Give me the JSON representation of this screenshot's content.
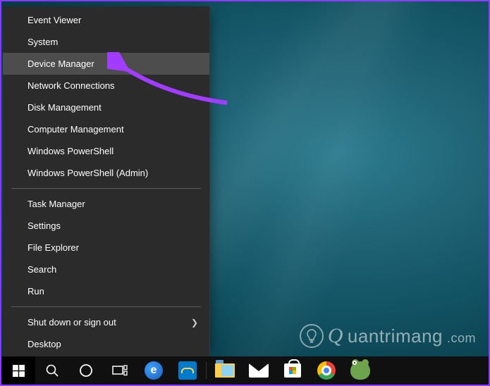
{
  "menu": {
    "groups": [
      [
        {
          "label": "Event Viewer",
          "hover": false
        },
        {
          "label": "System",
          "hover": false
        },
        {
          "label": "Device Manager",
          "hover": true
        },
        {
          "label": "Network Connections",
          "hover": false
        },
        {
          "label": "Disk Management",
          "hover": false
        },
        {
          "label": "Computer Management",
          "hover": false
        },
        {
          "label": "Windows PowerShell",
          "hover": false
        },
        {
          "label": "Windows PowerShell (Admin)",
          "hover": false
        }
      ],
      [
        {
          "label": "Task Manager",
          "hover": false
        },
        {
          "label": "Settings",
          "hover": false
        },
        {
          "label": "File Explorer",
          "hover": false
        },
        {
          "label": "Search",
          "hover": false
        },
        {
          "label": "Run",
          "hover": false
        }
      ],
      [
        {
          "label": "Shut down or sign out",
          "hover": false,
          "submenu": true
        },
        {
          "label": "Desktop",
          "hover": false
        }
      ]
    ]
  },
  "watermark": {
    "text": "uantrimang",
    "suffix": ".com"
  },
  "taskbar": {
    "start": "Start",
    "apps": [
      {
        "name": "edge",
        "title": "Microsoft Edge"
      },
      {
        "name": "dev3",
        "title": "Dev App"
      },
      {
        "name": "explorer",
        "title": "File Explorer"
      },
      {
        "name": "mail",
        "title": "Mail"
      },
      {
        "name": "store",
        "title": "Microsoft Store"
      },
      {
        "name": "chrome",
        "title": "Google Chrome"
      },
      {
        "name": "frog",
        "title": "App"
      }
    ]
  },
  "annotation": {
    "target": "Device Manager"
  }
}
